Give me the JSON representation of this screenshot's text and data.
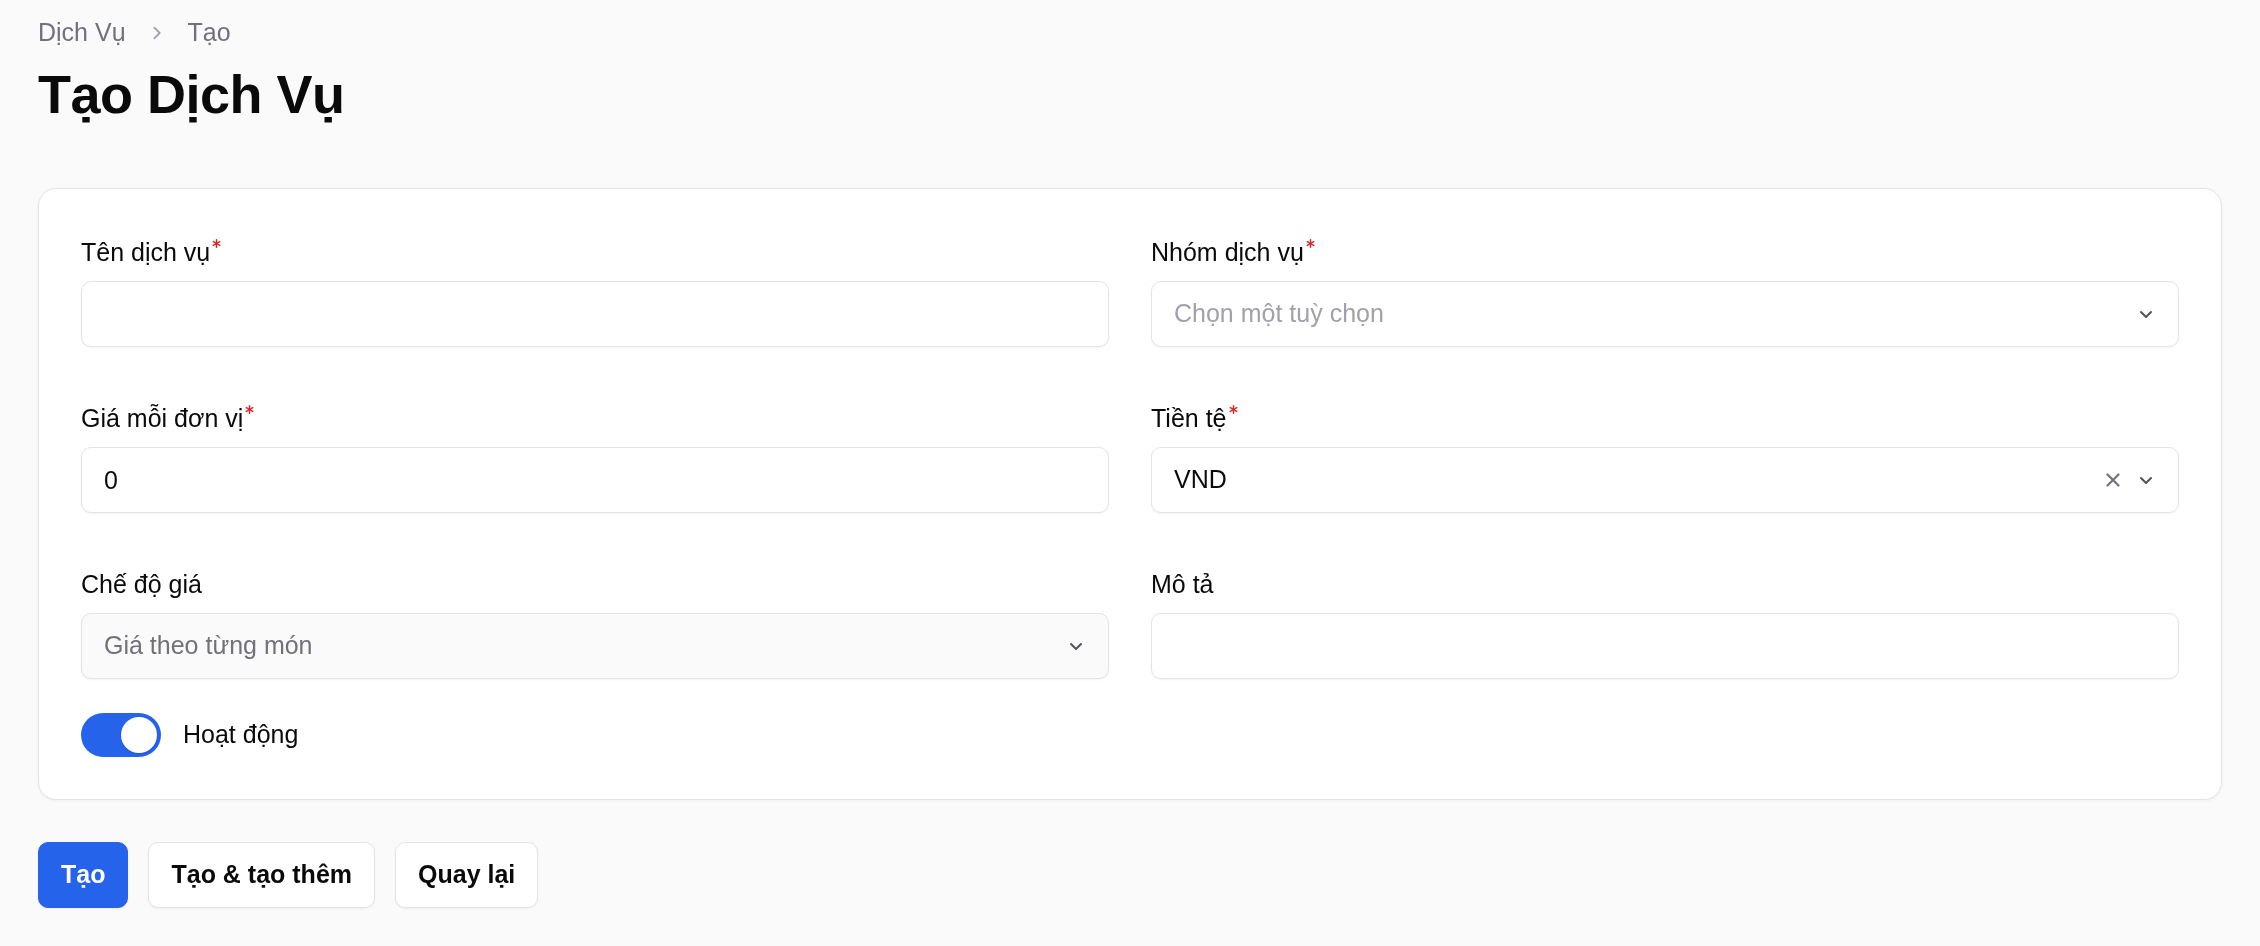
{
  "breadcrumbs": [
    "Dịch Vụ",
    "Tạo"
  ],
  "title": "Tạo Dịch Vụ",
  "fields": [
    {
      "label": "Tên dịch vụ",
      "required": true,
      "kind": "text"
    },
    {
      "label": "Nhóm dịch vụ",
      "required": true,
      "kind": "select",
      "placeholder": "Chọn một tuỳ chọn",
      "disabled": false,
      "clearable": false
    },
    {
      "label": "Giá mỗi đơn vị",
      "required": true,
      "kind": "text",
      "value": "0"
    },
    {
      "label": "Tiền tệ",
      "required": true,
      "kind": "select",
      "value": "VND",
      "disabled": false,
      "clearable": true
    },
    {
      "label": "Chế độ giá",
      "required": false,
      "kind": "select",
      "value": "Giá theo từng món",
      "disabled": true,
      "clearable": false
    },
    {
      "label": "Mô tả",
      "required": false,
      "kind": "text"
    }
  ],
  "toggle": {
    "label": "Hoạt động",
    "on": true
  },
  "buttons": [
    {
      "label": "Tạo",
      "kind": "primary"
    },
    {
      "label": "Tạo & tạo thêm",
      "kind": "secondary"
    },
    {
      "label": "Quay lại",
      "kind": "secondary"
    }
  ]
}
